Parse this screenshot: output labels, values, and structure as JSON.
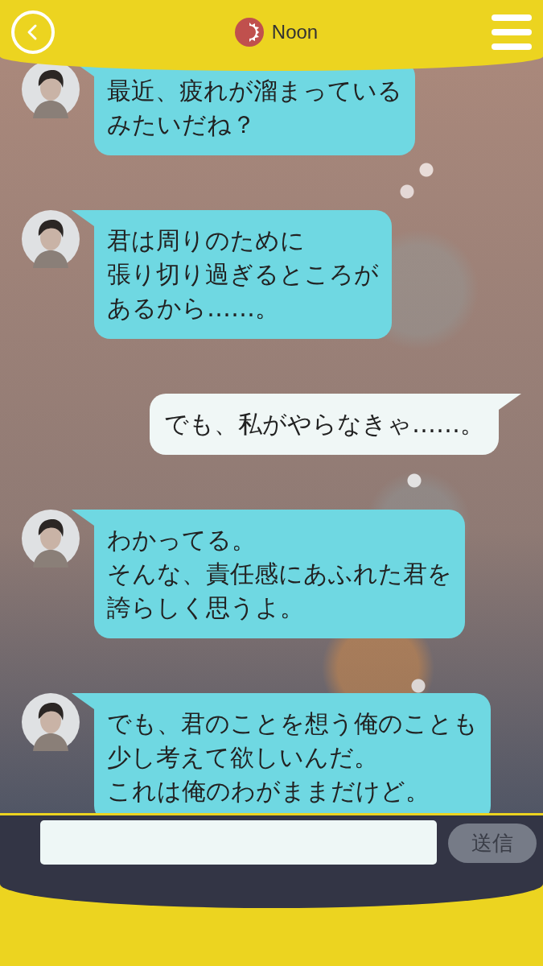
{
  "header": {
    "title": "Noon"
  },
  "messages": [
    {
      "kind": "received",
      "lines": [
        "最近、疲れが溜まっている",
        "みたいだね？"
      ]
    },
    {
      "kind": "received",
      "lines": [
        "君は周りのために",
        "張り切り過ぎるところが",
        "あるから……。"
      ]
    },
    {
      "kind": "sent",
      "lines": [
        "でも、私がやらなきゃ……。"
      ]
    },
    {
      "kind": "received",
      "lines": [
        "わかってる。",
        "そんな、責任感にあふれた君を",
        "誇らしく思うよ。"
      ]
    },
    {
      "kind": "received",
      "lines": [
        "でも、君のことを想う俺のことも",
        "少し考えて欲しいんだ。",
        "これは俺のわがままだけど。"
      ]
    }
  ],
  "composer": {
    "send_label": "送信"
  }
}
